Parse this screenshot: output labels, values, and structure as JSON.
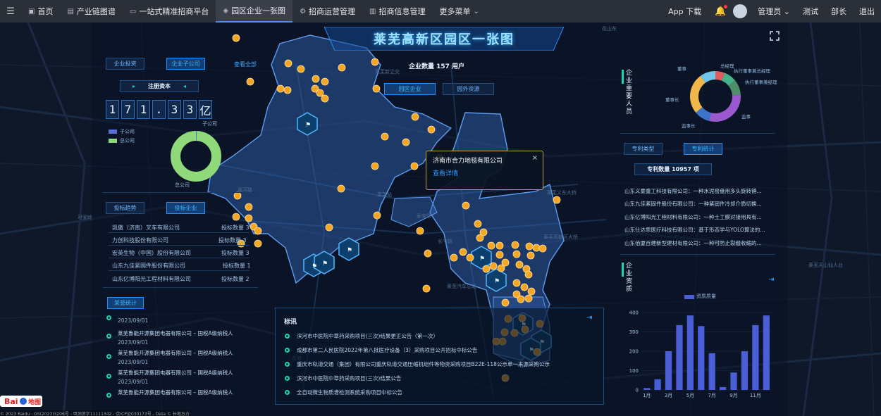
{
  "nav": {
    "items": [
      {
        "label": "首页",
        "icon": "home-icon"
      },
      {
        "label": "产业链图谱",
        "icon": "chain-icon"
      },
      {
        "label": "一站式精准招商平台",
        "icon": "monitor-icon"
      },
      {
        "label": "园区企业一张图",
        "icon": "map-icon",
        "active": true
      },
      {
        "label": "招商运营管理",
        "icon": "operate-icon"
      },
      {
        "label": "招商信息管理",
        "icon": "doc-icon"
      },
      {
        "label": "更多菜单",
        "icon": "chevron-down-icon"
      }
    ],
    "app_download": "App 下载",
    "user_role": "管理员",
    "right_links": [
      "测试",
      "部长",
      "退出"
    ]
  },
  "dashboard": {
    "title": "莱芜高新区园区一张图",
    "company_count_label": "企业数量 157 用户",
    "map_buttons": [
      "园区企业",
      "园外资源"
    ]
  },
  "left": {
    "tabs": [
      "企业投资",
      "企业子公司"
    ],
    "view_all": "查看全部",
    "capital_title": "注册资本",
    "capital_digits": [
      "1",
      "7",
      "1",
      ".",
      "3",
      "3",
      "亿"
    ],
    "legend": [
      {
        "label": "子公司",
        "color": "#5b6fd6"
      },
      {
        "label": "总公司",
        "color": "#8fd97a"
      }
    ],
    "donut_labels": {
      "top": "子公司",
      "bottom": "总公司"
    },
    "donut_data": [
      {
        "name": "子公司",
        "value": 0.001
      },
      {
        "name": "总公司",
        "value": 1
      }
    ],
    "bid_tabs": [
      "投标趋势",
      "投标企业"
    ],
    "bid_companies": [
      {
        "name": "凯傲（济南）叉车有限公司",
        "value": "投标数量 3"
      },
      {
        "name": "力创科技股份有限公司",
        "value": "投标数量 3"
      },
      {
        "name": "宏英生物（中国）股份有限公司",
        "value": "投标数量 3"
      },
      {
        "name": "山东九佳紧固件股份有限公司",
        "value": "投标数量 1"
      },
      {
        "name": "山东亿博阳光工程材料有限公司",
        "value": "投标数量 2"
      }
    ],
    "honor_title": "荣誉统计",
    "honors": [
      {
        "date": "2023/09/01",
        "text": ""
      },
      {
        "date": "",
        "text": "莱芜鲁能开源集团电器有限公司 – 国税A级纳税人"
      },
      {
        "date": "2023/09/01",
        "text": ""
      },
      {
        "date": "",
        "text": "莱芜鲁能开源集团电器有限公司 – 国税A级纳税人"
      },
      {
        "date": "2023/09/01",
        "text": ""
      },
      {
        "date": "",
        "text": "莱芜鲁能开源集团电器有限公司 – 国税A级纳税人"
      },
      {
        "date": "2023/09/01",
        "text": ""
      },
      {
        "date": "",
        "text": "莱芜鲁能开源集团电器有限公司 – 国税A级纳税人"
      }
    ]
  },
  "popup": {
    "company": "济南市合力地毯有限公司",
    "link": "查看详情",
    "close": "×"
  },
  "bids": {
    "title": "标讯",
    "items": [
      "滨河市中医院中草药采购项目(三次)结果更正公告（第一次）",
      "成都市第二人民医院2022年第八批医疗设备（3）采购项目公开招标中标公告",
      "重庆市轨道交通（集团）有限公司重庆轨道交通压缩机组件等物资采购项目B22E-118公示单一来源采购公示",
      "滨河市中医院中草药采购项目(三次)结果公告",
      "全自动微生物质谱检测系统采购项目中标公告"
    ]
  },
  "right": {
    "personnel_title": "企业重要人员",
    "personnel_labels": [
      "总经理",
      "执行董事兼总经理",
      "执行董事兼经理",
      "董事",
      "董事长",
      "监事",
      "监事长"
    ],
    "personnel_data": [
      {
        "name": "总经理",
        "value": 6
      },
      {
        "name": "执行董事兼总经理",
        "value": 8
      },
      {
        "name": "执行董事兼经理",
        "value": 10
      },
      {
        "name": "监事",
        "value": 30
      },
      {
        "name": "监事长",
        "value": 10
      },
      {
        "name": "董事",
        "value": 26
      },
      {
        "name": "董事长",
        "value": 10
      }
    ],
    "personnel_colors": [
      "#e05b5b",
      "#45b38a",
      "#4e8f6a",
      "#9b59d0",
      "#3b74c9",
      "#f0b84a",
      "#6fc6e8",
      "#f08a48",
      "#d8d8d8",
      "#e75a8f"
    ],
    "patent_tabs": [
      "专利类型",
      "专利统计"
    ],
    "patent_count": "专利数量 10957 项",
    "patents": [
      "山东义豪重工科技有限公司：一种水泥窑盘用多头旋转锤...",
      "山东九佳紧固件股份有限公司：一种紧固件冷却介质切换...",
      "山东亿博阳光工程材料有限公司：一种土工膜对接用具有...",
      "山东仕达思医疗科技有限公司：基于形态学与YOLO算法的...",
      "山东佰厦百建新型建材有限公司：一种可防止裂缝收缩的..."
    ],
    "resource_title": "企业资质",
    "resource_legend": "资质质量"
  },
  "chart_data": {
    "type": "bar",
    "categories": [
      "1月",
      "2月",
      "3月",
      "4月",
      "5月",
      "6月",
      "7月",
      "8月",
      "9月",
      "10月",
      "11月",
      "12月"
    ],
    "tick_labels": [
      "1月",
      "3月",
      "5月",
      "7月",
      "9月",
      "11月"
    ],
    "series": [
      {
        "name": "资质质量",
        "values": [
          10,
          55,
          200,
          335,
          385,
          330,
          190,
          15,
          90,
          200,
          335,
          385
        ]
      }
    ],
    "ylim": [
      0,
      400
    ],
    "yticks": [
      0,
      100,
      200,
      300,
      400
    ],
    "color": "#4a5ed6"
  },
  "map": {
    "labels": [
      "花山东",
      "莱芜站",
      "泰安路",
      "长勺路",
      "莱芜汽车总站",
      "莱芜新立交",
      "莱芜义东大桥",
      "莱芜高新区大桥",
      "嘉河路",
      "可家岭",
      "古城",
      "莱芜天山仙人台"
    ],
    "copyright": "© 2023 Baidu - GS(2023)3206号 - 甲测资字11111342 - 京ICP证030173号 - Data © 长地万方"
  }
}
